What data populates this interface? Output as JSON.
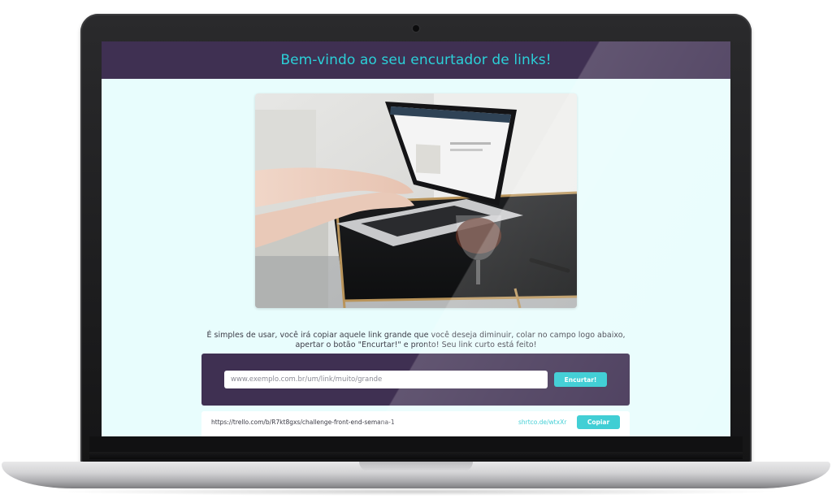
{
  "header": {
    "title": "Bem-vindo ao seu encurtador de links!"
  },
  "hero": {
    "image": "laptop-on-glass-table-photo"
  },
  "description": "É simples de usar, você irá copiar aquele link grande que você deseja diminuir, colar no campo logo abaixo, apertar o botão \"Encurtar!\" e pronto! Seu link curto está feito!",
  "form": {
    "input_placeholder": "www.exemplo.com.br/um/link/muito/grande",
    "input_value": "",
    "submit_label": "Encurtar!"
  },
  "results": [
    {
      "original_url": "https://trello.com/b/R7kt8gxs/challenge-front-end-semana-1",
      "short_url": "shrtco.de/wtxXr",
      "copy_label": "Copiar"
    }
  ],
  "colors": {
    "header_bg": "#3f3052",
    "accent": "#2bc9d0",
    "page_bg": "#e8fdfd"
  }
}
